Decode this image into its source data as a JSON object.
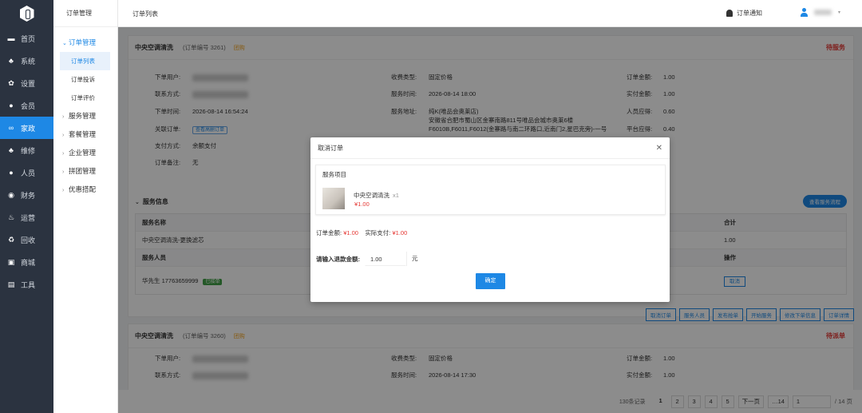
{
  "nav": {
    "items": [
      {
        "label": "首页",
        "icon": "monitor-icon"
      },
      {
        "label": "系统",
        "icon": "org-icon"
      },
      {
        "label": "设置",
        "icon": "gear-icon"
      },
      {
        "label": "会员",
        "icon": "user-icon"
      },
      {
        "label": "家政",
        "icon": "link-icon"
      },
      {
        "label": "维修",
        "icon": "org-icon"
      },
      {
        "label": "人员",
        "icon": "user-icon"
      },
      {
        "label": "财务",
        "icon": "coin-icon"
      },
      {
        "label": "运营",
        "icon": "fire-icon"
      },
      {
        "label": "回收",
        "icon": "recycle-icon"
      },
      {
        "label": "商城",
        "icon": "shop-icon"
      },
      {
        "label": "工具",
        "icon": "briefcase-icon"
      }
    ]
  },
  "submenu": {
    "title": "订单管理",
    "groups": [
      {
        "label": "订单管理",
        "children": [
          "订单列表",
          "订单投诉",
          "订单评价"
        ]
      },
      {
        "label": "服务管理"
      },
      {
        "label": "套餐管理"
      },
      {
        "label": "企业管理"
      },
      {
        "label": "拼团管理"
      },
      {
        "label": "优惠搭配"
      }
    ]
  },
  "header": {
    "breadcrumb": "订单列表",
    "notify": "订单通知"
  },
  "order1": {
    "title": "中央空调清洗",
    "number": "(订单编号 3261)",
    "tag": "团购",
    "status": "待服务",
    "labels": {
      "user": "下单用户:",
      "contact": "联系方式:",
      "time": "下单时间:",
      "linked": "关联订单:",
      "pay": "支付方式:",
      "remark": "订单备注:",
      "fee_type": "收费类型:",
      "svc_time": "服务时间:",
      "address": "服务地址:",
      "amount": "订单金额:",
      "paid": "实付金额:",
      "staff_due": "人员应得:",
      "platform_due": "平台应得:"
    },
    "values": {
      "time": "2026-08-14 16:54:24",
      "linked": "查看高删订单",
      "pay": "余额支付",
      "remark": "无",
      "fee_type": "固定价格",
      "svc_time": "2026-08-14 18:00",
      "address": "纯K(唯品会奥莱店)\n安徽省合肥市蜀山区金寨南路811号唯品会城市奥莱6楼F6010B,F6011,F6012(金寨路与南二环路口,近南门2,星巴克旁)-一号",
      "amount": "1.00",
      "paid": "1.00",
      "staff_due": "0.60",
      "platform_due": "0.40"
    },
    "service": {
      "title": "服务信息",
      "flow_btn": "查看服务流程",
      "col_name": "服务名称",
      "col_total": "合计",
      "item_name": "中央空调清洗-更换滤芯",
      "item_total": "1.00",
      "col_staff": "服务人员",
      "col_op": "操作",
      "staff": "华先生 17763659999",
      "staff_tag": "已接单",
      "cancel": "取消"
    },
    "actions": [
      "取消订单",
      "服务人员",
      "发布抢单",
      "开始服务",
      "修改下单信息",
      "订单详情"
    ]
  },
  "order2": {
    "title": "中央空调清洗",
    "number": "(订单编号 3260)",
    "tag": "团购",
    "status": "待派单",
    "labels": {
      "user": "下单用户:",
      "contact": "联系方式:",
      "fee_type": "收费类型:",
      "svc_time": "服务时间:",
      "amount": "订单金额:",
      "paid": "实付金额:"
    },
    "values": {
      "fee_type": "固定价格",
      "svc_time": "2026-08-14 17:30",
      "amount": "1.00",
      "paid": "1.00"
    }
  },
  "pager": {
    "total": "130条记录",
    "pages": [
      "1",
      "2",
      "3",
      "4",
      "5"
    ],
    "next": "下一页",
    "last": "14",
    "jump": "1",
    "of": "/ 14 页"
  },
  "dialog": {
    "title": "取消订单",
    "section": "服务项目",
    "item_name": "中央空调清洗",
    "item_qty": "x1",
    "item_price": "¥1.00",
    "amount_label": "订单金额:",
    "amount": "¥1.00",
    "paid_label": "实际支付:",
    "paid": "¥1.00",
    "refund_label": "请输入退款金额:",
    "refund_value": "1.00",
    "unit": "元",
    "confirm": "确定"
  }
}
